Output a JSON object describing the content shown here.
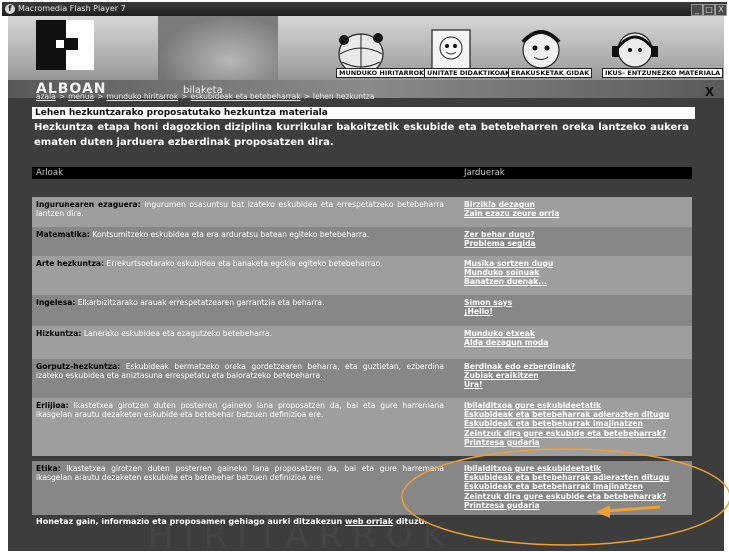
{
  "window": {
    "title": "Macromedia Flash Player 7",
    "controls": [
      "_",
      "□",
      "X"
    ]
  },
  "header": {
    "site_name": "ALBOAN",
    "search_label": "bilaketa",
    "close_label": "X",
    "nav": [
      {
        "label": "MUNDUKO HIRITARROK"
      },
      {
        "label": "UNITATE DIDAKTIKOAK"
      },
      {
        "label": "ERAKUSKETAK GIDAK"
      },
      {
        "label": "IKUS- ENTZUNEZKO MATERIALA"
      }
    ]
  },
  "breadcrumb": {
    "links": [
      "azala",
      "menua",
      "munduko hiritarrok",
      "eskubideak eta betebeharrak"
    ],
    "current": "lehen hezkuntza"
  },
  "section": {
    "title": "Lehen hezkuntzarako proposatutako hezkuntza materiala",
    "description": "Hezkuntza etapa honi dagozkion diziplina kurrikular bakoitzetik eskubide eta betebeharren oreka lantzeko aukera ematen duten jarduera ezberdinak proposatzen dira."
  },
  "table": {
    "headers": [
      "Arloak",
      "Jarduerak"
    ],
    "rows": [
      {
        "area": "Ingurunearen ezaguera:",
        "text": "Ingurumen osasuntsu bat izateko eskubidea eta errespetatzeko betebeharra lantzen dira.",
        "activities": [
          "Birzikla dezagun",
          "Zain ezazu zeure orria"
        ]
      },
      {
        "area": "Matematika:",
        "text": "Kontsumitzeko eskubidea eta era arduratsu batean egiteko betebeharra.",
        "activities": [
          "Zer behar dugu?",
          "Problema segida"
        ]
      },
      {
        "area": "Arte hezkuntza:",
        "text": "Errekurtsoetarako eskubidea eta banaketa egokia egiteko betebeharrao.",
        "activities": [
          "Musika sortzen dugu",
          "Munduko soinuak",
          "Banatzen duenak..."
        ]
      },
      {
        "area": "Ingelesa:",
        "text": "Elkarbizitzarako arauak errespetatzearen garrantzia eta beharra.",
        "activities": [
          "Simon says",
          "¡Hello!"
        ]
      },
      {
        "area": "Hizkuntza:",
        "text": "Lanerako eskubidea eta ezagutzeko betebeharra.",
        "activities": [
          "Munduko etxeak",
          "Alda dezagun moda"
        ]
      },
      {
        "area": "Gorputz-hezkuntza:",
        "text": "Eskubideak bermatzeko oreka gordetzearen beharra, eta guztietan, ezberdina izateko eskubidea eta aniztasuna errespetatu eta baloratzeko betebeharra.",
        "activities": [
          "Berdinak edo ezberdinak?",
          "Zubiak eraikitzen",
          "Ura!"
        ]
      },
      {
        "area": "Erlijioa:",
        "text": "Ikastetxea girotzen duten posterren gaineko lana proposatzen da, bai eta gure harremana ikasgelan arautu dezaketen eskubide eta betebehar batzuen definizioa ere.",
        "activities": [
          "Ibilalditxoa gure eskubideetatik",
          "Eskubideak eta betebeharrak adierazten ditugu",
          "Eskubideak eta betebeharrak imajinatzen",
          "Zeintzuk dira gure eskubide eta betebeharrak?",
          "Printzesa gudaria"
        ]
      },
      {
        "area": "Etika:",
        "text": "Ikastetxea girotzen duten posterren gaineko lana proposatzen da, bai eta gure harremana ikasgelan arautu dezaketen eskubide eta betebehar batzuen definizioa ere.",
        "activities": [
          "Ibilalditxoa gure eskubideetatik",
          "Eskubideak eta betebeharrak adierazten ditugu",
          "Eskubideak eta betebeharrak imajinatzen",
          "Zeintzuk dira gure eskubide eta betebeharrak?",
          "Printzesa gudaria"
        ]
      }
    ]
  },
  "footer": {
    "text": "Honetaz gain, informazio eta proposamen gehiago aurki ditzakezun",
    "link": "web orriak",
    "tail": "dituzu."
  },
  "watermark": "HIRITARROK",
  "colors": {
    "annotation": "#f0a030",
    "background": "#3d3d3d",
    "row_even": "#878787",
    "row_odd": "#9e9e9e"
  }
}
